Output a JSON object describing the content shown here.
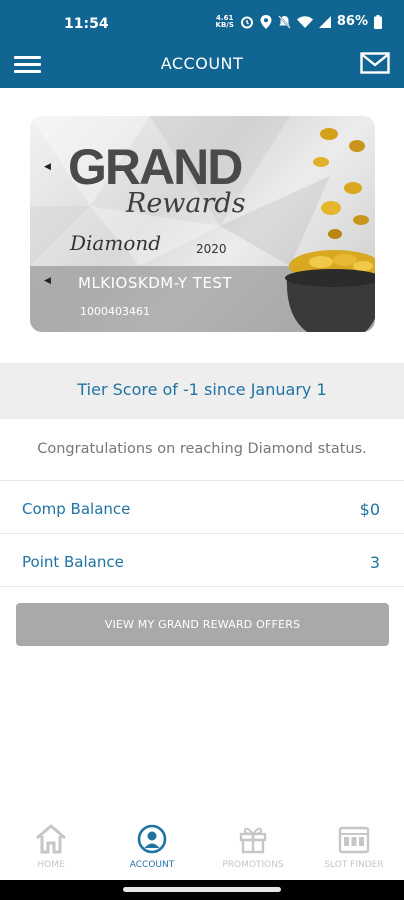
{
  "status_bar": {
    "time": "11:54",
    "speed_value": "4.61",
    "speed_unit": "KB/S",
    "battery": "86%"
  },
  "app_bar": {
    "title": "ACCOUNT",
    "menu_icon": "hamburger-menu-icon",
    "mail_icon": "mail-icon"
  },
  "card": {
    "brand_line1": "GRAND",
    "brand_line2": "Rewards",
    "tier_name": "Diamond",
    "year": "2020",
    "member_name": "MLKIOSKDM-Y TEST",
    "member_number": "1000403461"
  },
  "tier_score": "Tier Score of -1 since January 1",
  "status_message": "Congratulations on reaching Diamond status.",
  "balances": [
    {
      "label": "Comp Balance",
      "value": "$0"
    },
    {
      "label": "Point Balance",
      "value": "3"
    }
  ],
  "offers_button": "VIEW MY GRAND REWARD OFFERS",
  "tabs": [
    {
      "label": "HOME",
      "icon": "home-icon",
      "active": false
    },
    {
      "label": "ACCOUNT",
      "icon": "user-icon",
      "active": true
    },
    {
      "label": "PROMOTIONS",
      "icon": "gift-icon",
      "active": false
    },
    {
      "label": "SLOT FINDER",
      "icon": "slot-machine-icon",
      "active": false
    }
  ],
  "colors": {
    "header": "#116592",
    "accent": "#1f73a3",
    "button": "#a7a9ab",
    "tier_bg": "#eeeeee",
    "inactive_tab": "#c6c6c6"
  }
}
